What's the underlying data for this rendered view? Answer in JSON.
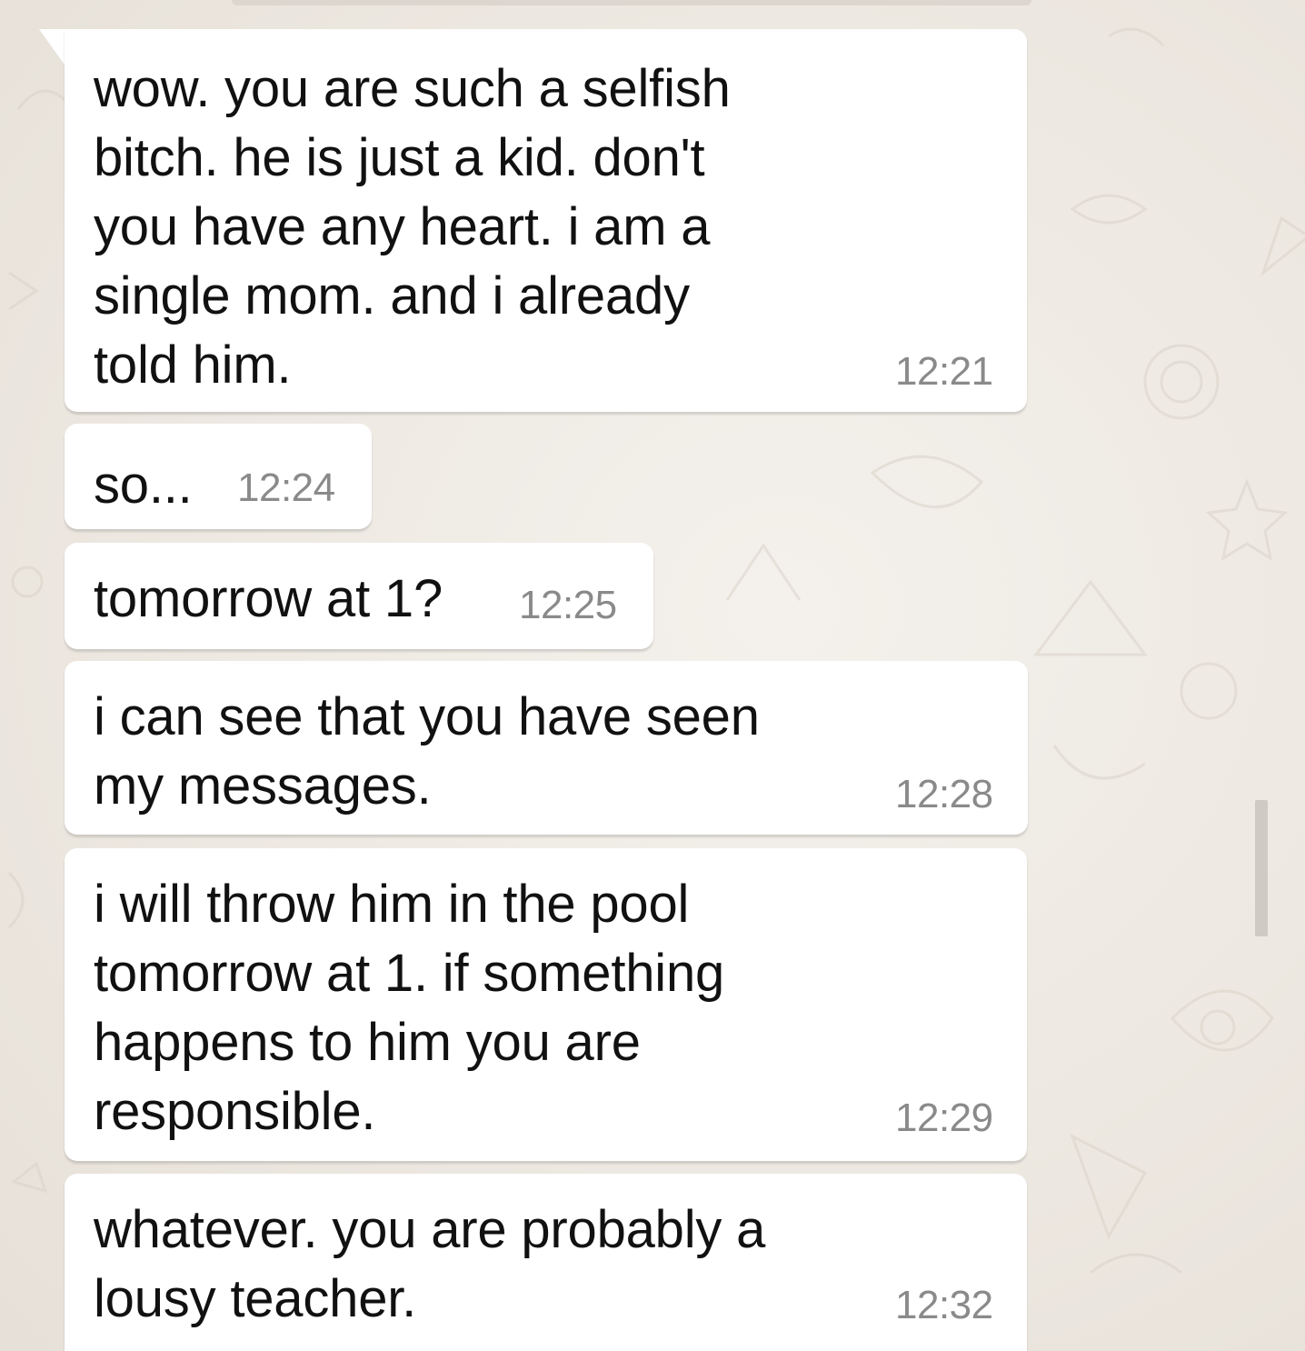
{
  "chat": {
    "messages": [
      {
        "text": "wow. you are such a selfish\nbitch. he is just a kid. don't\nyou have any heart. i am a\nsingle mom. and i already\ntold him.",
        "time": "12:21"
      },
      {
        "text": "so...",
        "time": "12:24"
      },
      {
        "text": "tomorrow at 1?",
        "time": "12:25"
      },
      {
        "text": "i can see that you have seen\nmy messages.",
        "time": "12:28"
      },
      {
        "text": "i will throw him in the pool\ntomorrow at 1. if something\nhappens to him you are\nresponsible.",
        "time": "12:29"
      },
      {
        "text": "whatever. you are probably a\nlousy teacher.",
        "time": "12:32"
      }
    ]
  },
  "colors": {
    "bubble": "#ffffff",
    "text": "#111111",
    "timestamp": "#8a8a8a",
    "wallpaper": "#ece5dd"
  }
}
